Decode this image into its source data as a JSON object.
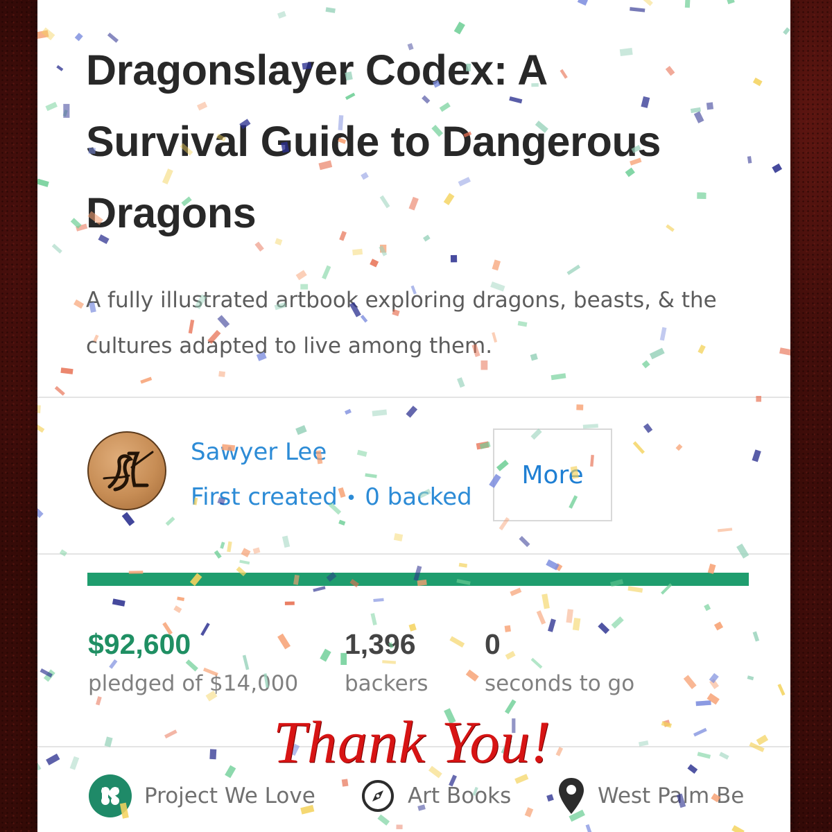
{
  "project": {
    "title": "Dragonslayer Codex: A Survival Guide to Dangerous Dragons",
    "blurb": "A fully illustrated artbook exploring dragons, beasts, & the cultures adapted to live among them."
  },
  "creator": {
    "name": "Sawyer Lee",
    "first_created": "First created",
    "separator": "•",
    "backed": "0 backed",
    "more_label": "More"
  },
  "funding": {
    "progress_percent": 100,
    "pledged_amount": "$92,600",
    "pledged_label": "pledged of $14,000",
    "backers_count": "1,396",
    "backers_label": "backers",
    "time_left": "0",
    "time_label": "seconds to go"
  },
  "tags": {
    "badge": "Project We Love",
    "category": "Art Books",
    "location": "West Palm Be"
  },
  "overlay": {
    "thank_you": "Thank You!"
  },
  "colors": {
    "accent_green": "#1f9d6e",
    "link_blue": "#2c8bd6",
    "thank_you_red": "#d71414"
  },
  "icons": {
    "badge": "kickstarter-k-icon",
    "category": "compass-icon",
    "location": "map-pin-icon"
  }
}
